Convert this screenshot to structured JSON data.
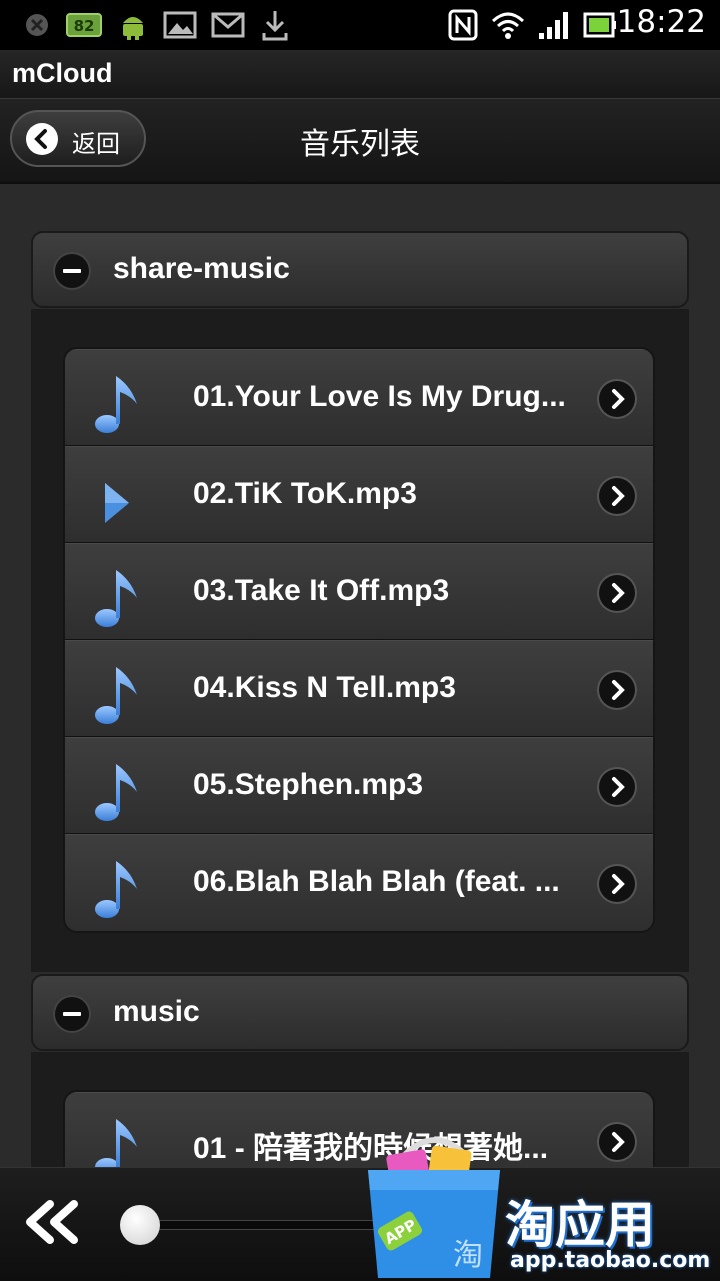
{
  "status_bar": {
    "time": "18:22",
    "battery_badge": "82",
    "icons": [
      "usb-debug-icon",
      "battery-badge-icon",
      "android-icon",
      "gallery-icon",
      "gmail-icon",
      "download-icon",
      "nfc-icon",
      "wifi-icon",
      "signal-icon",
      "battery-icon"
    ]
  },
  "app": {
    "title": "mCloud"
  },
  "nav": {
    "back_label": "返回",
    "title": "音乐列表"
  },
  "groups": [
    {
      "name": "share-music",
      "items": [
        {
          "title": "01.Your Love Is My Drug...",
          "icon": "music-note-icon"
        },
        {
          "title": "02.TiK ToK.mp3",
          "icon": "play-icon"
        },
        {
          "title": "03.Take It Off.mp3",
          "icon": "music-note-icon"
        },
        {
          "title": "04.Kiss N Tell.mp3",
          "icon": "music-note-icon"
        },
        {
          "title": "05.Stephen.mp3",
          "icon": "music-note-icon"
        },
        {
          "title": "06.Blah Blah Blah (feat. ...",
          "icon": "music-note-icon"
        }
      ]
    },
    {
      "name": "music",
      "items": [
        {
          "title": "01 - 陪著我的時候想著她...",
          "icon": "music-note-icon"
        }
      ]
    }
  ],
  "player": {
    "progress": 0.0
  },
  "ad": {
    "brand": "淘应用",
    "url": "app.taobao.com",
    "badge": "APP",
    "mark": "淘"
  },
  "colors": {
    "accent_blue": "#4a8fe0",
    "background": "#2b2b2b"
  }
}
